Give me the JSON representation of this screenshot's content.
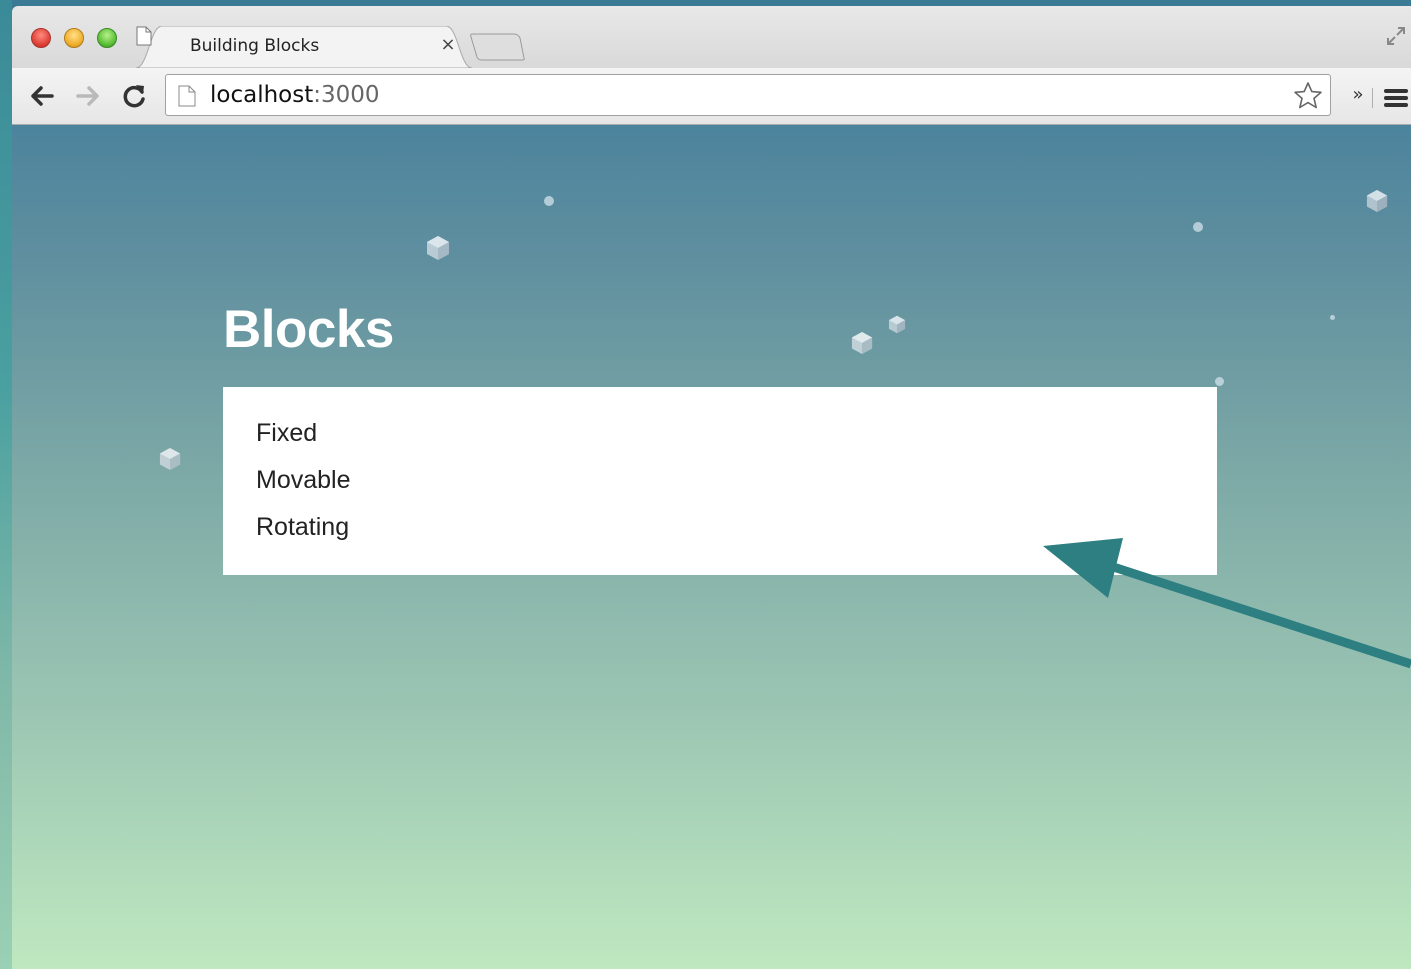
{
  "browser": {
    "tab_title": "Building Blocks",
    "tab_close": "×",
    "url_host": "localhost",
    "url_port": ":3000",
    "more_label": "»"
  },
  "page": {
    "title": "Blocks",
    "items": [
      {
        "label": "Fixed"
      },
      {
        "label": "Movable"
      },
      {
        "label": "Rotating"
      }
    ]
  },
  "colors": {
    "arrow": "#2e7f82",
    "panel": "#ffffff",
    "title_text": "#ffffff"
  },
  "icons": {
    "back": "back-arrow-icon",
    "forward": "forward-arrow-icon",
    "reload": "reload-icon",
    "star": "star-icon",
    "menu": "hamburger-menu-icon",
    "page": "page-icon",
    "fullscreen": "fullscreen-icon",
    "cube": "cube-icon"
  }
}
